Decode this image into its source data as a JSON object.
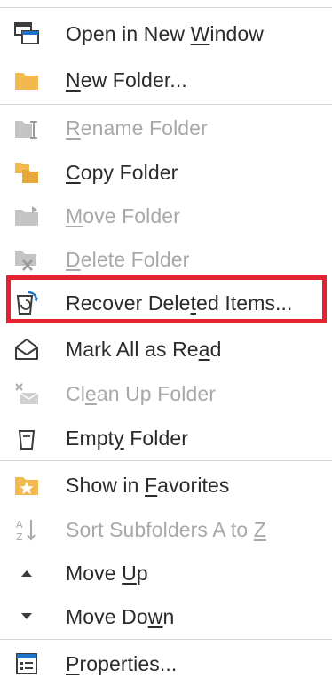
{
  "colors": {
    "folder": "#f3b94f",
    "disabled": "#b9b9b9",
    "text": "#2b2b2b",
    "disabled_text": "#a8a8a8",
    "highlight": "#e5222f"
  },
  "menu": {
    "items": [
      {
        "id": "open-new-window",
        "pre": "Open in New ",
        "key": "W",
        "post": "indow",
        "icon": "window-icon",
        "disabled": false
      },
      {
        "id": "new-folder",
        "pre": "",
        "key": "N",
        "post": "ew Folder...",
        "icon": "folder-icon",
        "disabled": false
      },
      {
        "id": "rename-folder",
        "pre": "",
        "key": "R",
        "post": "ename Folder",
        "icon": "rename-folder-icon",
        "disabled": true
      },
      {
        "id": "copy-folder",
        "pre": "",
        "key": "C",
        "post": "opy Folder",
        "icon": "copy-folder-icon",
        "disabled": false
      },
      {
        "id": "move-folder",
        "pre": "",
        "key": "M",
        "post": "ove Folder",
        "icon": "move-folder-icon",
        "disabled": true
      },
      {
        "id": "delete-folder",
        "pre": "",
        "key": "D",
        "post": "elete Folder",
        "icon": "delete-folder-icon",
        "disabled": true
      },
      {
        "id": "recover-deleted-items",
        "pre": "Recover Dele",
        "key": "t",
        "post": "ed Items...",
        "icon": "recover-bin-icon",
        "disabled": false
      },
      {
        "id": "mark-all-read",
        "pre": "Mark All as Re",
        "key": "a",
        "post": "d",
        "icon": "open-envelope-icon",
        "disabled": false
      },
      {
        "id": "clean-up-folder",
        "pre": "Cl",
        "key": "e",
        "post": "an Up Folder",
        "icon": "clean-up-icon",
        "disabled": true
      },
      {
        "id": "empty-folder",
        "pre": "Empt",
        "key": "y",
        "post": " Folder",
        "icon": "trash-bin-icon",
        "disabled": false
      },
      {
        "id": "show-in-favorites",
        "pre": "Show in ",
        "key": "F",
        "post": "avorites",
        "icon": "favorite-folder-icon",
        "disabled": false
      },
      {
        "id": "sort-subfolders",
        "pre": "Sort Subfolders A to ",
        "key": "Z",
        "post": "",
        "icon": "sort-az-icon",
        "disabled": true
      },
      {
        "id": "move-up",
        "pre": "Move ",
        "key": "U",
        "post": "p",
        "icon": "triangle-up-icon",
        "disabled": false
      },
      {
        "id": "move-down",
        "pre": "Move Do",
        "key": "w",
        "post": "n",
        "icon": "triangle-down-icon",
        "disabled": false
      },
      {
        "id": "properties",
        "pre": "",
        "key": "P",
        "post": "roperties...",
        "icon": "properties-icon",
        "disabled": false
      }
    ]
  }
}
